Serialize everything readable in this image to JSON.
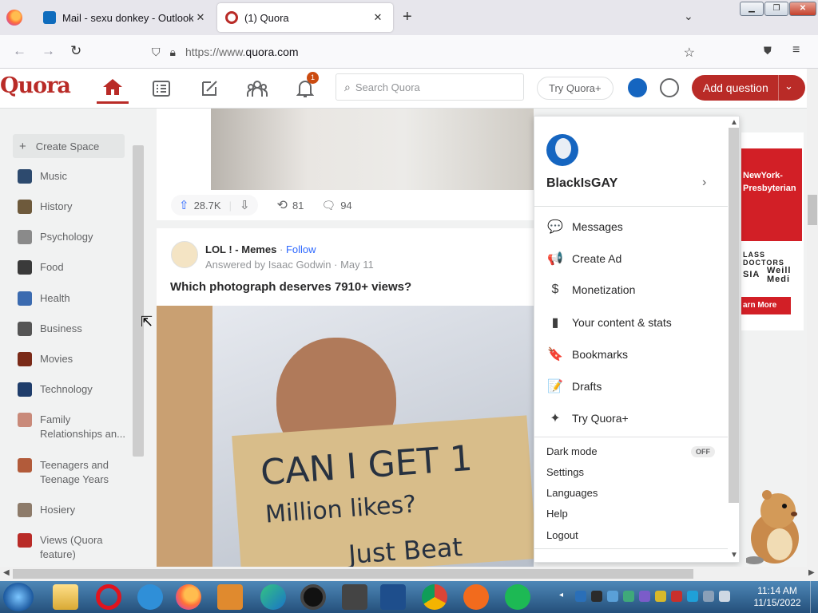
{
  "browser": {
    "tabs": [
      {
        "title": "Mail - sexu donkey - Outlook",
        "favicon_color": "#0f6cbd",
        "active": false
      },
      {
        "title": "(1) Quora",
        "favicon_color": "#b92b27",
        "active": true
      }
    ],
    "url_protocol": "https://www.",
    "url_host": "quora.com",
    "new_tab_label": "+",
    "close_glyph": "✕"
  },
  "quora": {
    "logo": "Quora",
    "notification_count": "1",
    "search_placeholder": "Search Quora",
    "try_plus": "Try Quora+",
    "add_question": "Add question",
    "brand_color": "#b92b27"
  },
  "sidebar": {
    "create_space": "Create Space",
    "items": [
      {
        "label": "Music",
        "color": "#2d4a6e"
      },
      {
        "label": "History",
        "color": "#6e5a3c"
      },
      {
        "label": "Psychology",
        "color": "#8a8a8a"
      },
      {
        "label": "Food",
        "color": "#3a3a3a"
      },
      {
        "label": "Health",
        "color": "#3b6bb0"
      },
      {
        "label": "Business",
        "color": "#555555"
      },
      {
        "label": "Movies",
        "color": "#7a2a18"
      },
      {
        "label": "Technology",
        "color": "#1f3d6b"
      },
      {
        "label": "Family Relationships an...",
        "color": "#c98a7a"
      },
      {
        "label": "Teenagers and Teenage Years",
        "color": "#b25b3a"
      },
      {
        "label": "Hosiery",
        "color": "#8d7b6a"
      },
      {
        "label": "Views (Quora feature)",
        "color": "#b92b27"
      }
    ]
  },
  "feed": {
    "post1": {
      "upvotes": "28.7K",
      "shares": "81",
      "comments": "94"
    },
    "post2": {
      "space": "LOL ! - Memes",
      "separator": "·",
      "follow": "Follow",
      "byline": "Answered by Isaac Godwin · May 11",
      "question": "Which photograph deserves 7910+ views?",
      "sign_line1": "CAN I GET 1",
      "sign_line2": "Million likes?",
      "sign_line3": "Just Beat"
    }
  },
  "profile_menu": {
    "username": "BlackIsGAY",
    "items": [
      {
        "label": "Messages",
        "icon": "chat-bubble-icon",
        "glyph": "💬"
      },
      {
        "label": "Create Ad",
        "icon": "megaphone-icon",
        "glyph": "📢"
      },
      {
        "label": "Monetization",
        "icon": "dollar-icon",
        "glyph": "$"
      },
      {
        "label": "Your content & stats",
        "icon": "bar-chart-icon",
        "glyph": "▮"
      },
      {
        "label": "Bookmarks",
        "icon": "bookmark-icon",
        "glyph": "🔖"
      },
      {
        "label": "Drafts",
        "icon": "drafts-icon",
        "glyph": "📝"
      },
      {
        "label": "Try Quora+",
        "icon": "sparkle-icon",
        "glyph": "✦"
      }
    ],
    "dark_mode": "Dark mode",
    "dark_mode_state": "OFF",
    "settings": "Settings",
    "languages": "Languages",
    "help": "Help",
    "logout": "Logout"
  },
  "ad": {
    "brand_line1": "NewYork-",
    "brand_line2": "Presbyterian",
    "tagline": "LASS DOCTORS",
    "partner_left": "SIA",
    "partner_right": "Weill Medi",
    "cta": "arn More"
  },
  "taskbar": {
    "time": "11:14 AM",
    "date": "11/15/2022"
  }
}
